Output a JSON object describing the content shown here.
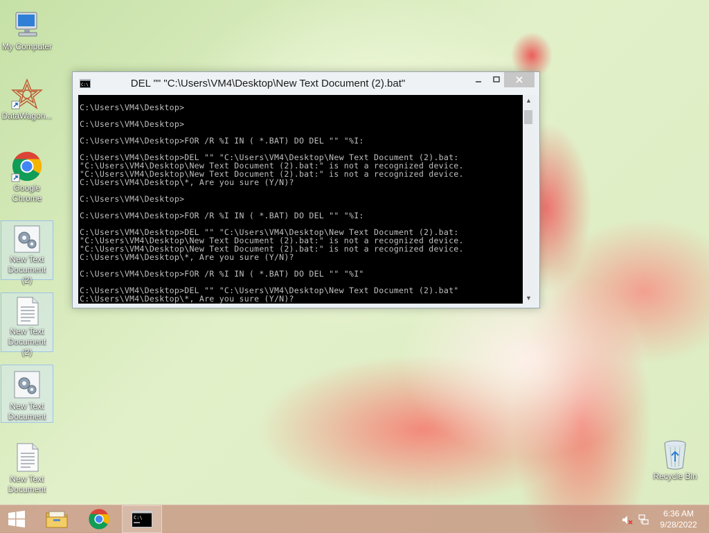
{
  "desktop": {
    "icons": [
      {
        "name": "My Computer"
      },
      {
        "name": "DataWagon..."
      },
      {
        "name": "Google Chrome"
      },
      {
        "name": "New Text Document (2)"
      },
      {
        "name": "New Text Document (2)"
      },
      {
        "name": "New Text Document"
      },
      {
        "name": "New Text Document"
      },
      {
        "name": "Recycle Bin"
      }
    ]
  },
  "cmd": {
    "title": "DEL  \"\" \"C:\\Users\\VM4\\Desktop\\New Text Document (2).bat\"",
    "lines": [
      "",
      "C:\\Users\\VM4\\Desktop>",
      "",
      "C:\\Users\\VM4\\Desktop>",
      "",
      "C:\\Users\\VM4\\Desktop>FOR /R %I IN ( *.BAT) DO DEL \"\" \"%I:",
      "",
      "C:\\Users\\VM4\\Desktop>DEL \"\" \"C:\\Users\\VM4\\Desktop\\New Text Document (2).bat:",
      "\"C:\\Users\\VM4\\Desktop\\New Text Document (2).bat:\" is not a recognized device.",
      "\"C:\\Users\\VM4\\Desktop\\New Text Document (2).bat:\" is not a recognized device.",
      "C:\\Users\\VM4\\Desktop\\*, Are you sure (Y/N)?",
      "",
      "C:\\Users\\VM4\\Desktop>",
      "",
      "C:\\Users\\VM4\\Desktop>FOR /R %I IN ( *.BAT) DO DEL \"\" \"%I:",
      "",
      "C:\\Users\\VM4\\Desktop>DEL \"\" \"C:\\Users\\VM4\\Desktop\\New Text Document (2).bat:",
      "\"C:\\Users\\VM4\\Desktop\\New Text Document (2).bat:\" is not a recognized device.",
      "\"C:\\Users\\VM4\\Desktop\\New Text Document (2).bat:\" is not a recognized device.",
      "C:\\Users\\VM4\\Desktop\\*, Are you sure (Y/N)?",
      "",
      "C:\\Users\\VM4\\Desktop>FOR /R %I IN ( *.BAT) DO DEL \"\" \"%I\"",
      "",
      "C:\\Users\\VM4\\Desktop>DEL \"\" \"C:\\Users\\VM4\\Desktop\\New Text Document (2).bat\"",
      "C:\\Users\\VM4\\Desktop\\*, Are you sure (Y/N)?"
    ]
  },
  "taskbar": {
    "time": "6:36 AM",
    "date": "9/28/2022",
    "buttons": [
      "start-button",
      "file-explorer",
      "google-chrome",
      "command-prompt"
    ]
  },
  "colors": {
    "console_bg": "#000000",
    "console_text": "#c0c0c0",
    "close_button": "#c7c7c7"
  }
}
